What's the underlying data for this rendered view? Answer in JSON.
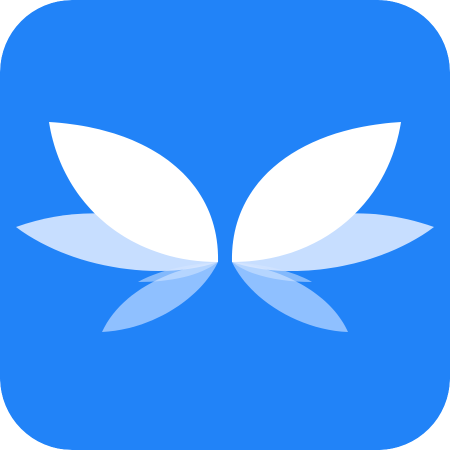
{
  "app_icon": {
    "icon_name": "butterfly-app-icon",
    "colors": {
      "background": "#2183F8",
      "wing_primary": "#FFFFFF",
      "wing_secondary": "#D6E6FF",
      "wing_tertiary": "#96C3FF"
    }
  }
}
